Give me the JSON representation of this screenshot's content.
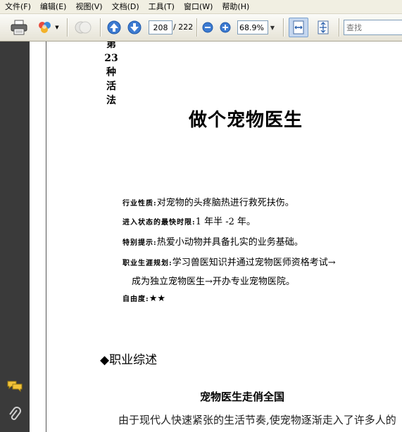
{
  "menu": [
    "文件(F)",
    "编辑(E)",
    "视图(V)",
    "文档(D)",
    "工具(T)",
    "窗口(W)",
    "帮助(H)"
  ],
  "toolbar": {
    "page_current": "208",
    "page_total": "/ 222",
    "zoom": "68.9%",
    "search_placeholder": "查找"
  },
  "document": {
    "side_title": [
      "第",
      "23",
      "种",
      "活",
      "法"
    ],
    "title": "做个宠物医生",
    "info": [
      {
        "label": "行业性质:",
        "value": "对宠物的头疼脑热进行救死扶伤。"
      },
      {
        "label": "进入状态的最快时限:",
        "value": "1 年半 -2 年。"
      },
      {
        "label": "特别提示:",
        "value": "热爱小动物并具备扎实的业务基础。"
      },
      {
        "label": "职业生涯规划:",
        "value": "学习兽医知识并通过宠物医师资格考试→"
      },
      {
        "label": "",
        "value": "成为独立宠物医生→开办专业宠物医院。"
      },
      {
        "label": "自由度:",
        "value": "★★"
      }
    ],
    "section_heading": "◆职业综述",
    "sub_heading": "宠物医生走俏全国",
    "body_line": "由于现代人快速紧张的生活节奏,使宠物逐渐走入了许多人的"
  }
}
